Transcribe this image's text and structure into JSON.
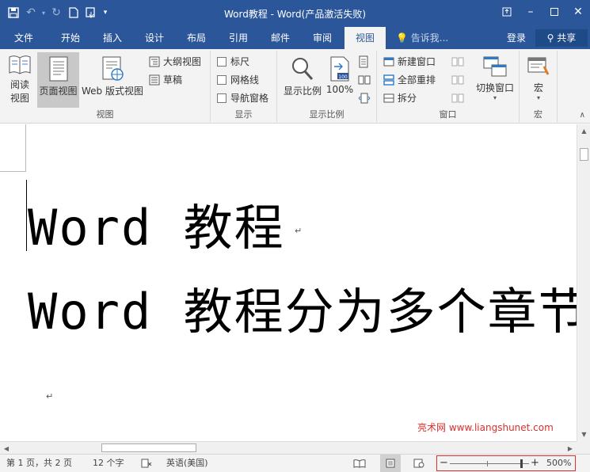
{
  "title": "Word教程 - Word(产品激活失败)",
  "tabs": [
    "文件",
    "开始",
    "插入",
    "设计",
    "布局",
    "引用",
    "邮件",
    "审阅",
    "视图"
  ],
  "active_tab": "视图",
  "tell_me": "告诉我...",
  "login": "登录",
  "share": "共享",
  "ribbon": {
    "views": {
      "label": "视图",
      "read_mode": "阅读视图",
      "read_l1": "阅读",
      "read_l2": "视图",
      "print_layout": "页面视图",
      "web_layout": "Web 版式视图",
      "outline": "大纲视图",
      "draft": "草稿"
    },
    "show": {
      "label": "显示",
      "ruler": "标尺",
      "gridlines": "网格线",
      "nav_pane": "导航窗格"
    },
    "zoom": {
      "label": "显示比例",
      "zoom": "显示比例",
      "hundred": "100%",
      "icon_text": "100"
    },
    "window": {
      "label": "窗口",
      "new_window": "新建窗口",
      "arrange_all": "全部重排",
      "split": "拆分",
      "switch_windows": "切换窗口"
    },
    "macros": {
      "label": "宏",
      "macros": "宏"
    }
  },
  "document": {
    "line1": "Word 教程",
    "line2": "Word 教程分为多个章节"
  },
  "watermark": "亮术网 www.liangshunet.com",
  "status": {
    "page": "第 1 页，共 2 页",
    "words": "12 个字",
    "language": "英语(美国)",
    "zoom": "500%",
    "zoom_level_fraction": 0.9
  },
  "colors": {
    "brand": "#2b579a",
    "watermark": "#d9302c",
    "zoom_box_border": "#e03030"
  }
}
